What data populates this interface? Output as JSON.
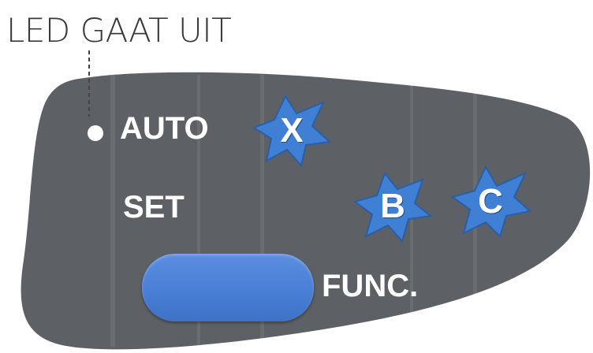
{
  "callout": {
    "text": "LED GAAT UIT"
  },
  "panel": {
    "auto_label": "AUTO",
    "set_label": "SET",
    "func_label": "FUNC."
  },
  "buttons": {
    "x_letter": "X",
    "b_letter": "B",
    "c_letter": "C"
  },
  "colors": {
    "panel": "#5d6064",
    "star_fill": "#3f7fd4",
    "star_stroke": "#2a5fa8",
    "func_button": "#4a7fd6",
    "text_light": "#ffffff",
    "callout_text": "#3a3a3a"
  }
}
